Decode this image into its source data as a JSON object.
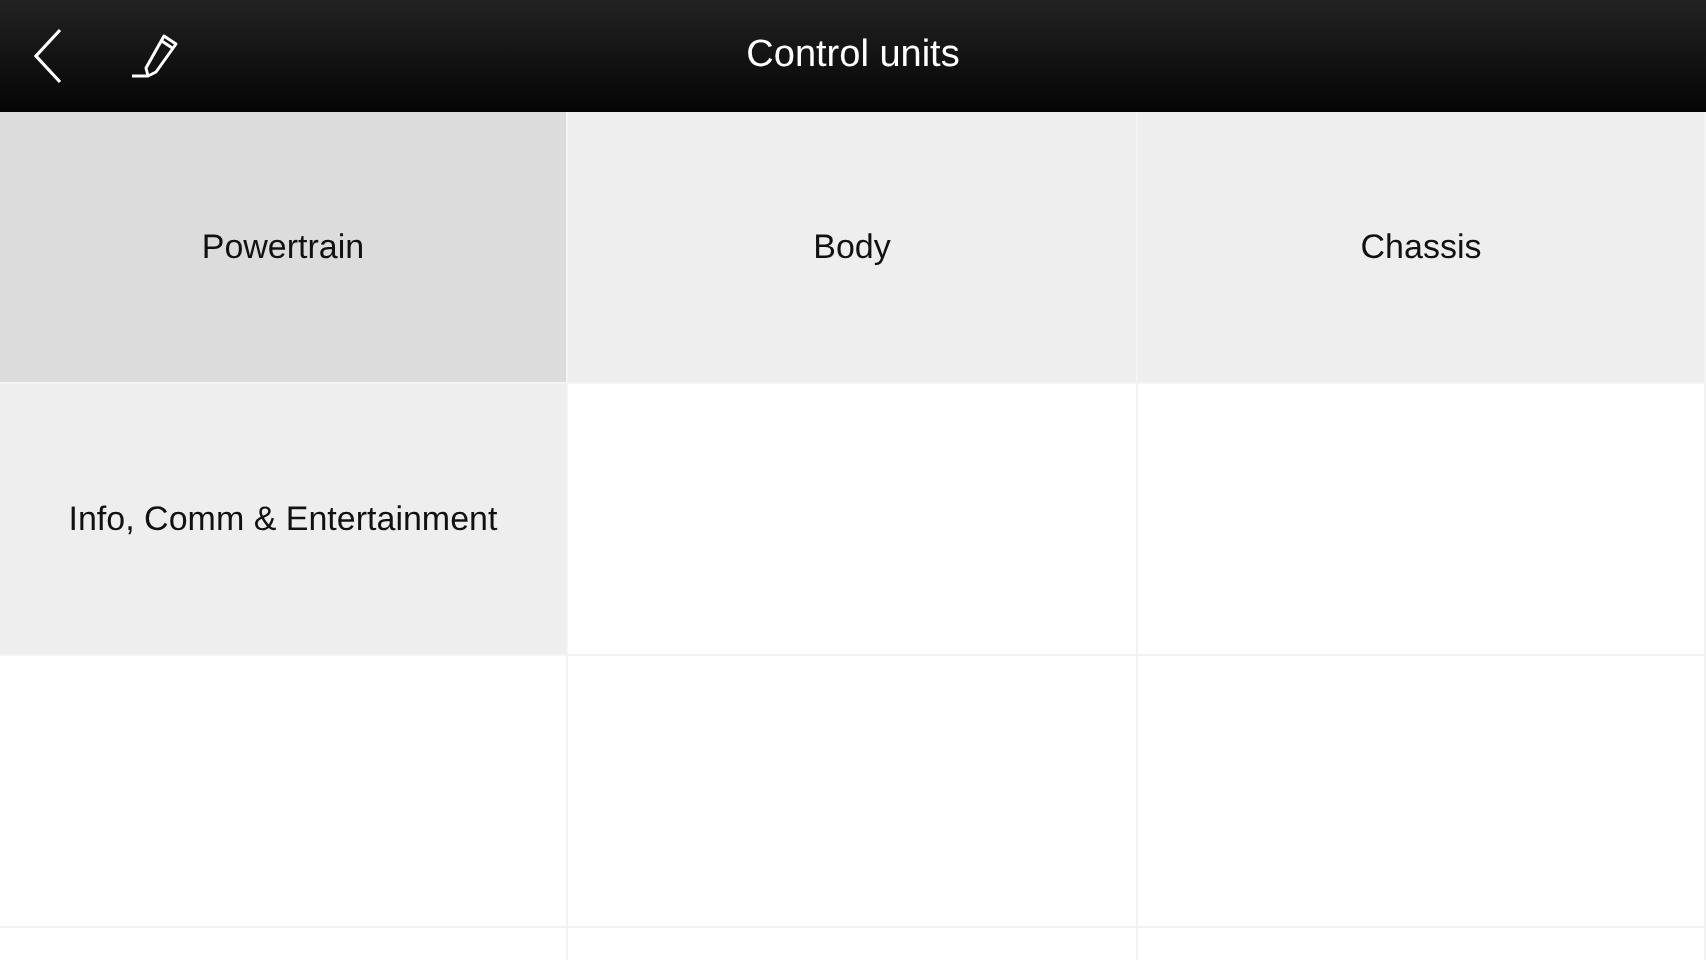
{
  "header": {
    "title": "Control units"
  },
  "units": [
    {
      "label": "Powertrain",
      "selected": true
    },
    {
      "label": "Body",
      "selected": false
    },
    {
      "label": "Chassis",
      "selected": false
    },
    {
      "label": "Info, Comm & Entertainment",
      "selected": false
    }
  ]
}
